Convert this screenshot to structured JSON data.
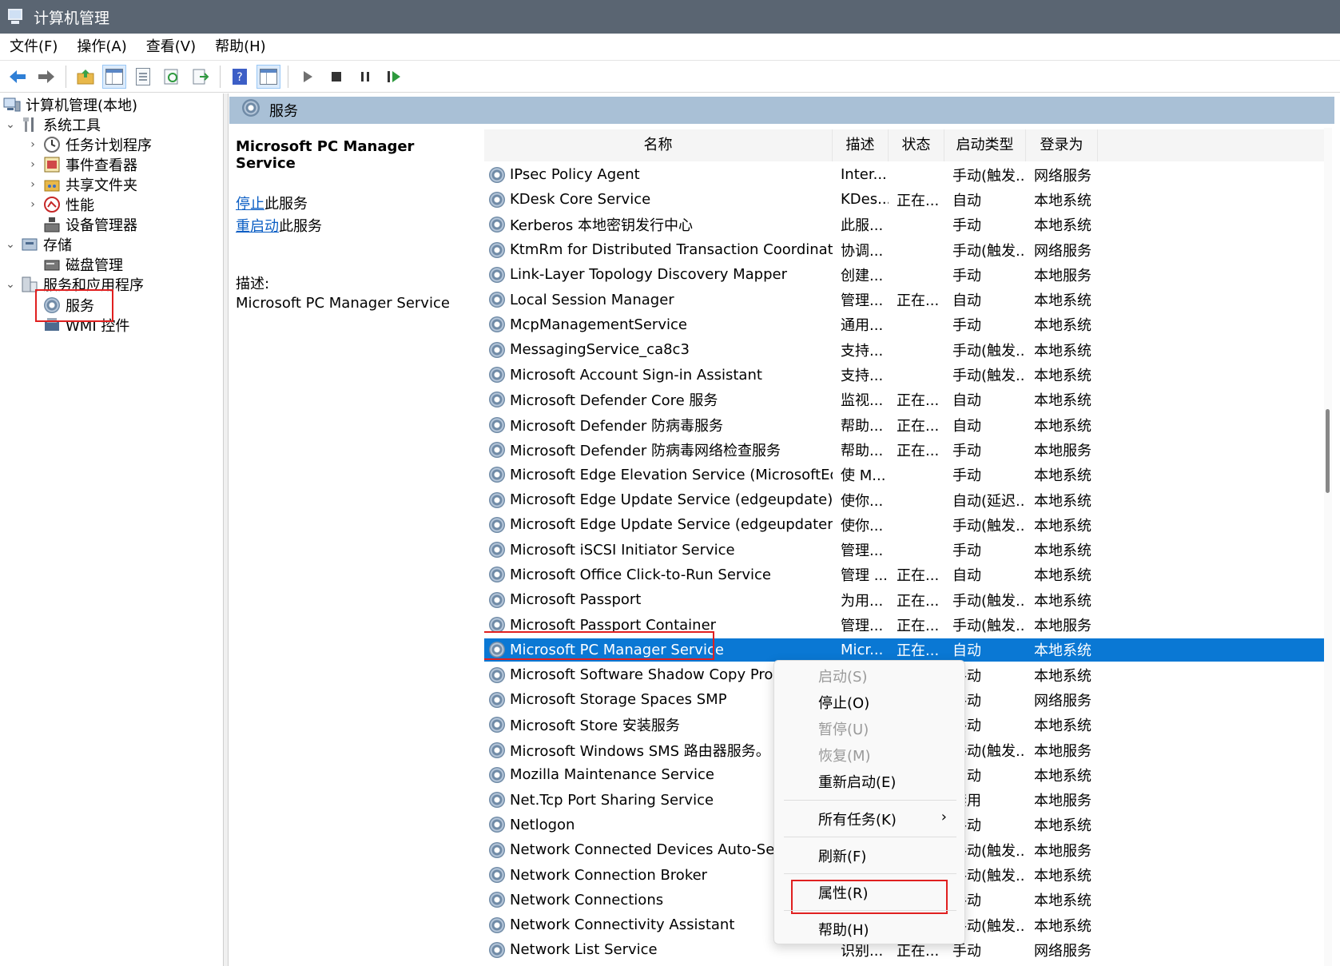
{
  "window": {
    "title": "计算机管理"
  },
  "menu": [
    "文件(F)",
    "操作(A)",
    "查看(V)",
    "帮助(H)"
  ],
  "tree": {
    "root": "计算机管理(本地)",
    "system_tools": "系统工具",
    "task_scheduler": "任务计划程序",
    "event_viewer": "事件查看器",
    "shared_folders": "共享文件夹",
    "performance": "性能",
    "device_manager": "设备管理器",
    "storage": "存储",
    "disk_management": "磁盘管理",
    "services_apps": "服务和应用程序",
    "services": "服务",
    "wmi": "WMI 控件"
  },
  "main": {
    "header": "服务",
    "selected_title": "Microsoft PC Manager Service",
    "stop_link": "停止",
    "stop_suffix": "此服务",
    "restart_link": "重启动",
    "restart_suffix": "此服务",
    "desc_label": "描述:",
    "desc_text": "Microsoft PC Manager Service"
  },
  "columns": [
    "名称",
    "描述",
    "状态",
    "启动类型",
    "登录为"
  ],
  "rows": [
    [
      "IPsec Policy Agent",
      "Inter...",
      "",
      "手动(触发...",
      "网络服务"
    ],
    [
      "KDesk Core Service",
      "KDes...",
      "正在...",
      "自动",
      "本地系统"
    ],
    [
      "Kerberos 本地密钥发行中心",
      "此服...",
      "",
      "手动",
      "本地系统"
    ],
    [
      "KtmRm for Distributed Transaction Coordinator",
      "协调...",
      "",
      "手动(触发...",
      "网络服务"
    ],
    [
      "Link-Layer Topology Discovery Mapper",
      "创建...",
      "",
      "手动",
      "本地服务"
    ],
    [
      "Local Session Manager",
      "管理...",
      "正在...",
      "自动",
      "本地系统"
    ],
    [
      "McpManagementService",
      "通用...",
      "",
      "手动",
      "本地系统"
    ],
    [
      "MessagingService_ca8c3",
      "支持...",
      "",
      "手动(触发...",
      "本地系统"
    ],
    [
      "Microsoft Account Sign-in Assistant",
      "支持...",
      "",
      "手动(触发...",
      "本地系统"
    ],
    [
      "Microsoft Defender Core 服务",
      "监视...",
      "正在...",
      "自动",
      "本地系统"
    ],
    [
      "Microsoft Defender 防病毒服务",
      "帮助...",
      "正在...",
      "自动",
      "本地系统"
    ],
    [
      "Microsoft Defender 防病毒网络检查服务",
      "帮助...",
      "正在...",
      "手动",
      "本地服务"
    ],
    [
      "Microsoft Edge Elevation Service (MicrosoftEdgeEl...",
      "使 M...",
      "",
      "手动",
      "本地系统"
    ],
    [
      "Microsoft Edge Update Service (edgeupdate)",
      "使你...",
      "",
      "自动(延迟...",
      "本地系统"
    ],
    [
      "Microsoft Edge Update Service (edgeupdatem)",
      "使你...",
      "",
      "手动(触发...",
      "本地系统"
    ],
    [
      "Microsoft iSCSI Initiator Service",
      "管理...",
      "",
      "手动",
      "本地系统"
    ],
    [
      "Microsoft Office Click-to-Run Service",
      "管理 ...",
      "正在...",
      "自动",
      "本地系统"
    ],
    [
      "Microsoft Passport",
      "为用...",
      "正在...",
      "手动(触发...",
      "本地系统"
    ],
    [
      "Microsoft Passport Container",
      "管理...",
      "正在...",
      "手动(触发...",
      "本地服务"
    ],
    [
      "Microsoft PC Manager Service",
      "Micr...",
      "正在...",
      "自动",
      "本地系统"
    ],
    [
      "Microsoft Software Shadow Copy Provider",
      "",
      "",
      "手动",
      "本地系统"
    ],
    [
      "Microsoft Storage Spaces SMP",
      "",
      "",
      "手动",
      "网络服务"
    ],
    [
      "Microsoft Store 安装服务",
      "",
      "",
      "手动",
      "本地系统"
    ],
    [
      "Microsoft Windows SMS 路由器服务。",
      "",
      "",
      "手动(触发...",
      "本地服务"
    ],
    [
      "Mozilla Maintenance Service",
      "",
      "",
      "自动",
      "本地系统"
    ],
    [
      "Net.Tcp Port Sharing Service",
      "",
      "",
      "禁用",
      "本地服务"
    ],
    [
      "Netlogon",
      "",
      "",
      "手动",
      "本地系统"
    ],
    [
      "Network Connected Devices Auto-Setup",
      "",
      "",
      "手动(触发...",
      "本地服务"
    ],
    [
      "Network Connection Broker",
      "",
      "",
      "手动(触发...",
      "本地系统"
    ],
    [
      "Network Connections",
      "",
      "",
      "手动",
      "本地系统"
    ],
    [
      "Network Connectivity Assistant",
      "",
      "",
      "手动(触发...",
      "本地系统"
    ],
    [
      "Network List Service",
      "识别...",
      "正在...",
      "手动",
      "网络服务"
    ]
  ],
  "context_menu": {
    "start": "启动(S)",
    "stop": "停止(O)",
    "pause": "暂停(U)",
    "resume": "恢复(M)",
    "restart": "重新启动(E)",
    "all_tasks": "所有任务(K)",
    "refresh": "刷新(F)",
    "properties": "属性(R)",
    "help": "帮助(H)"
  },
  "colors": {
    "selection": "#0a78d4",
    "highlight_box": "#e02020",
    "header_band": "#a9c0d6",
    "titlebar": "#5a6572"
  }
}
